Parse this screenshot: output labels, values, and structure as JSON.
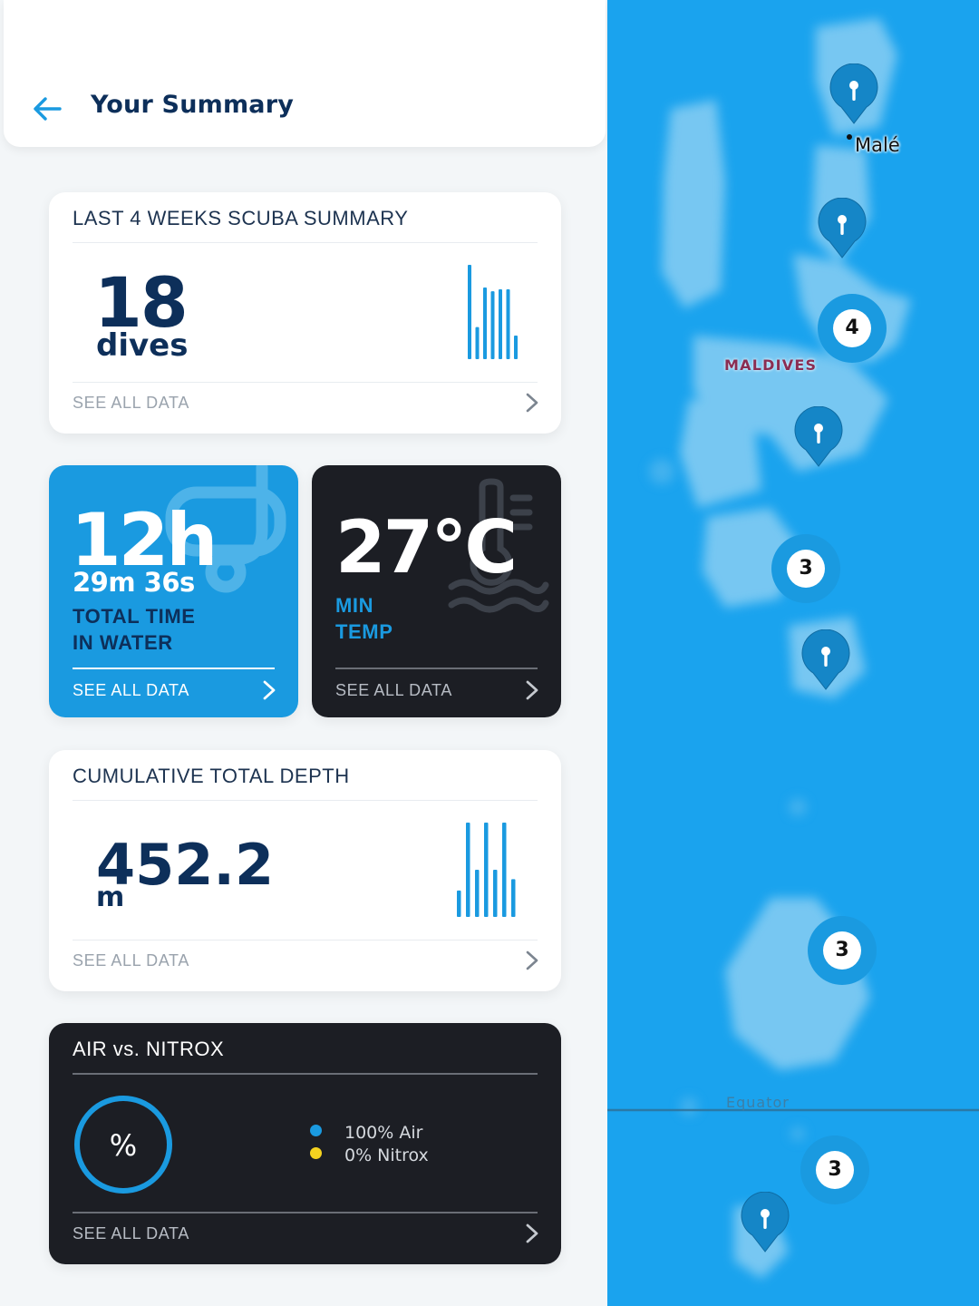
{
  "header": {
    "title": "Your Summary"
  },
  "dives_card": {
    "heading": "LAST 4 WEEKS SCUBA SUMMARY",
    "value": "18",
    "unit": "dives",
    "link": "SEE ALL DATA",
    "bar_levels": [
      1.0,
      0.34,
      0.76,
      0.72,
      0.74,
      0.74,
      0.25
    ]
  },
  "time_card": {
    "value": "12h",
    "sub_value": "29m 36s",
    "label_line1": "TOTAL TIME",
    "label_line2": "IN WATER",
    "link": "SEE ALL DATA"
  },
  "temp_card": {
    "value": "27°C",
    "label_line1": "MIN",
    "label_line2": "TEMP",
    "link": "SEE ALL DATA"
  },
  "depth_card": {
    "heading": "CUMULATIVE TOTAL DEPTH",
    "value": "452.2",
    "unit": "m",
    "link": "SEE ALL DATA",
    "bar_levels": [
      0.28,
      1.0,
      0.5,
      1.0,
      0.5,
      1.0,
      0.4
    ]
  },
  "gas_card": {
    "heading": "AIR vs. NITROX",
    "donut_symbol": "%",
    "legend": [
      {
        "label": "100% Air",
        "color": "#1a9ae0",
        "percent": 100
      },
      {
        "label": "0% Nitrox",
        "color": "#f4d21f",
        "percent": 0
      }
    ],
    "link": "SEE ALL DATA"
  },
  "map": {
    "city_label": "Malé",
    "country_label": "MALDIVES",
    "equator_label": "Equator",
    "clusters": [
      "4",
      "3",
      "3",
      "3"
    ]
  },
  "colors": {
    "accent": "#1a9ae0",
    "navy": "#0d2f5a",
    "dark_card": "#1c1e24",
    "ocean": "#1aa3ee"
  }
}
